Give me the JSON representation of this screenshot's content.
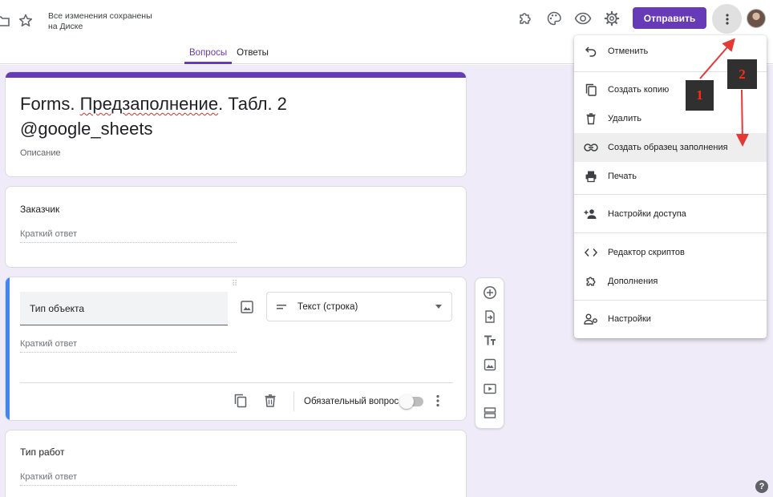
{
  "header": {
    "save_status": "Все изменения сохранены на Диске",
    "send_label": "Отправить",
    "icons": [
      "folder-icon",
      "star-icon",
      "addon-puzzle-icon",
      "palette-icon",
      "eye-icon",
      "gear-icon",
      "more-vert-icon"
    ]
  },
  "tabs": [
    {
      "label": "Вопросы",
      "active": true
    },
    {
      "label": "Ответы",
      "active": false
    }
  ],
  "form": {
    "title_part1": "Forms. ",
    "title_part2": "Предзаполнение",
    "title_part3": ". Табл. 2 @google_sheets",
    "description": "Описание"
  },
  "questions": [
    {
      "label": "Заказчик",
      "answer_hint": "Краткий ответ"
    },
    {
      "label": "Тип объекта",
      "answer_hint": "Краткий ответ",
      "type": "Текст (строка)",
      "required_label": "Обязательный вопрос",
      "required": false
    },
    {
      "label": "Тип работ",
      "answer_hint": "Краткий ответ"
    }
  ],
  "menu": {
    "items": [
      {
        "label": "Отменить",
        "icon": "undo-icon"
      },
      {
        "label": "Создать копию",
        "icon": "copy-icon"
      },
      {
        "label": "Удалить",
        "icon": "trash-icon"
      },
      {
        "label": "Создать образец заполнения",
        "icon": "link-icon",
        "highlighted": true
      },
      {
        "label": "Печать",
        "icon": "print-icon"
      },
      {
        "label": "Настройки доступа",
        "icon": "person-add-icon"
      },
      {
        "label": "Редактор скриптов",
        "icon": "code-icon"
      },
      {
        "label": "Дополнения",
        "icon": "puzzle-icon"
      },
      {
        "label": "Настройки",
        "icon": "person-settings-icon"
      }
    ]
  },
  "annotations": {
    "badge_1": "1",
    "badge_2": "2"
  },
  "colors": {
    "accent": "#673ab7",
    "active_question_bar": "#4285f4",
    "canvas": "#f0ebf8",
    "annotation": "#e53935"
  }
}
